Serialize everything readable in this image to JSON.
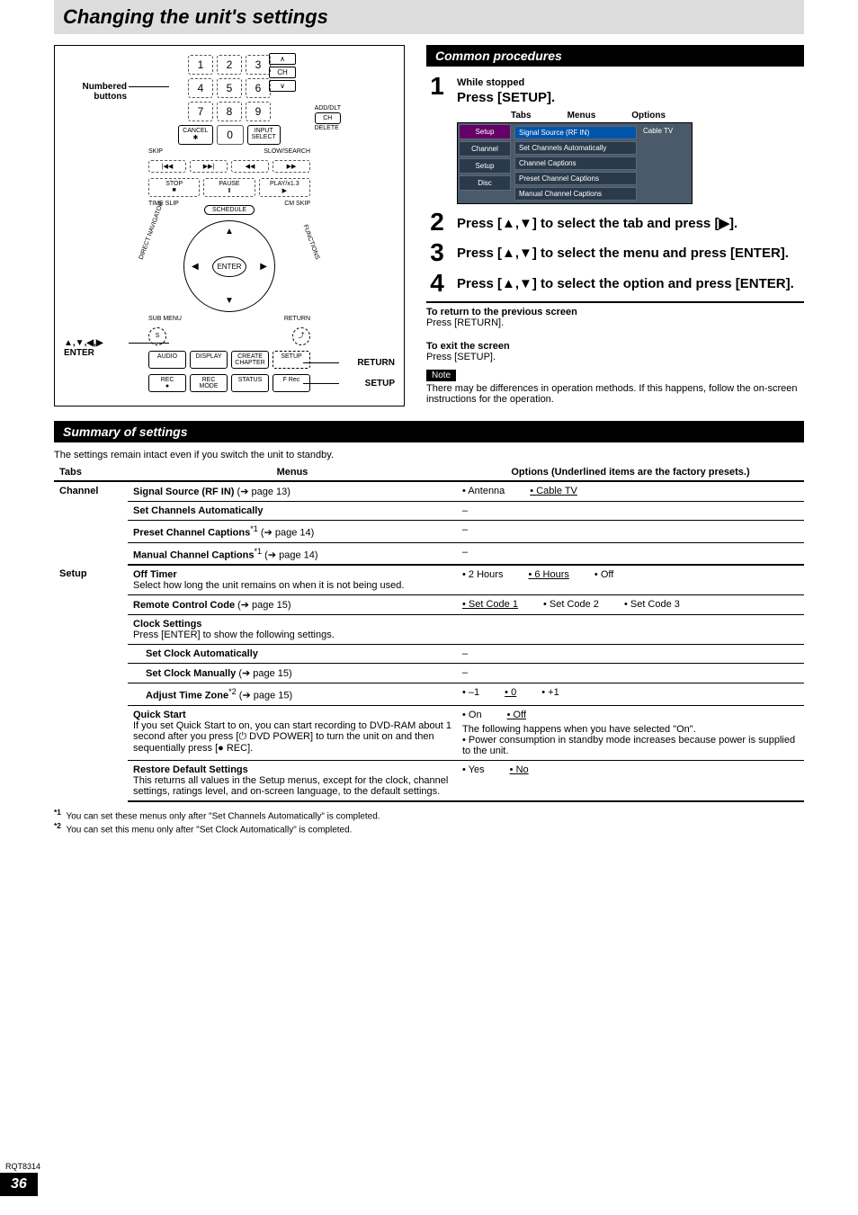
{
  "title": "Changing the unit's settings",
  "remote": {
    "label_numbered": "Numbered buttons",
    "label_enter": "▲,▼,◀,▶\nENTER",
    "label_return": "RETURN",
    "label_setup": "SETUP",
    "keys": [
      "1",
      "2",
      "3",
      "4",
      "5",
      "6",
      "7",
      "8",
      "9",
      "0"
    ],
    "side1_top": "∧",
    "side1_mid": "CH",
    "side1_bot": "∨",
    "side2_a": "ADD/DLT",
    "side2_b": "CH",
    "side2_c": "DELETE",
    "cancel": "CANCEL\n✱",
    "input": "INPUT\nSELECT",
    "skip": "SKIP",
    "slow": "SLOW/SEARCH",
    "prev": "|◀◀",
    "next": "▶▶|",
    "rew": "◀◀",
    "fwd": "▶▶",
    "stop": "STOP\n■",
    "pause": "PAUSE\nⅡ",
    "play": "PLAY/x1.3\n▶",
    "timeslip": "TIME SLIP",
    "cmskip": "CM SKIP",
    "schedule": "SCHEDULE",
    "enter": "ENTER",
    "submenu": "SUB MENU",
    "return": "RETURN",
    "s": "S",
    "row_audio": "AUDIO",
    "row_display": "DISPLAY",
    "row_create": "CREATE\nCHAPTER",
    "row_setup": "SETUP",
    "row2_rec": "REC",
    "row2_recmode": "REC MODE",
    "row2_status": "STATUS",
    "row2_frec": "F Rec",
    "direct": "DIRECT NAVIGATOR",
    "functions": "FUNCTIONS"
  },
  "procedures": {
    "header": "Common procedures",
    "step1_small": "While stopped",
    "step1_main": "Press [SETUP].",
    "osd_tabs_label": "Tabs",
    "osd_menus_label": "Menus",
    "osd_options_label": "Options",
    "osd_tab1": "Setup",
    "osd_tab2": "Channel",
    "osd_tab3": "Setup",
    "osd_tab4": "Disc",
    "osd_m1": "Signal Source (RF IN)",
    "osd_m2": "Set Channels Automatically",
    "osd_m3": "Channel Captions",
    "osd_m4": "Preset Channel Captions",
    "osd_m5": "Manual Channel Captions",
    "osd_opt": "Cable TV",
    "step2": "Press [▲,▼] to select the tab and press [▶].",
    "step3": "Press [▲,▼] to select the menu and press [ENTER].",
    "step4": "Press [▲,▼] to select the option and press [ENTER].",
    "return_h": "To return to the previous screen",
    "return_t": "Press [RETURN].",
    "exit_h": "To exit the screen",
    "exit_t": "Press [SETUP].",
    "note_label": "Note",
    "note_t": "There may be differences in operation methods. If this happens, follow the on-screen instructions for the operation."
  },
  "summary": {
    "header": "Summary of settings",
    "intro": "The settings remain intact even if you switch the unit to standby.",
    "col_tabs": "Tabs",
    "col_menus": "Menus",
    "col_options": "Options (Underlined items are the factory presets.)",
    "tab_channel": "Channel",
    "tab_setup": "Setup",
    "rows": {
      "signal": {
        "menu": "Signal Source (RF IN)",
        "ref": " (➔ page 13)",
        "opts": [
          "Antenna",
          "Cable TV"
        ],
        "u": []
      },
      "setch": {
        "menu": "Set Channels Automatically",
        "opts": [
          "–"
        ]
      },
      "preset": {
        "menu": "Preset Channel Captions",
        "sup": "*1",
        "ref": " (➔ page 14)",
        "opts": [
          "–"
        ]
      },
      "manual": {
        "menu": "Manual Channel Captions",
        "sup": "*1",
        "ref": " (➔ page 14)",
        "opts": [
          "–"
        ]
      },
      "off": {
        "menu": "Off Timer",
        "desc": "Select how long the unit remains on when it is not being used.",
        "opts": [
          "2 Hours",
          "6 Hours",
          "Off"
        ],
        "u": [
          1
        ]
      },
      "rcc": {
        "menu": "Remote Control Code",
        "ref": " (➔ page 15)",
        "opts": [
          "Set Code 1",
          "Set Code 2",
          "Set Code 3"
        ],
        "u": [
          0
        ]
      },
      "clock": {
        "menu": "Clock Settings",
        "desc": "Press [ENTER] to show the following settings."
      },
      "clk_auto": {
        "menu": "Set Clock Automatically",
        "opts": [
          "–"
        ]
      },
      "clk_man": {
        "menu": "Set Clock Manually",
        "ref": " (➔ page 15)",
        "opts": [
          "–"
        ]
      },
      "clk_tz": {
        "menu": "Adjust Time Zone",
        "sup": "*2",
        "ref": " (➔ page 15)",
        "opts": [
          "–1",
          "0",
          "+1"
        ],
        "u": [
          1
        ]
      },
      "quick": {
        "menu": "Quick Start",
        "desc": "If you set Quick Start to on, you can start recording to DVD-RAM about 1 second after you press [⏻ DVD POWER] to turn the unit on and then sequentially press [● REC].",
        "opts": [
          "On",
          "Off"
        ],
        "u": [
          1
        ],
        "extra": "The following happens when you have selected \"On\".\n• Power consumption in standby mode increases because power is supplied to the unit."
      },
      "restore": {
        "menu": "Restore Default Settings",
        "desc": "This returns all values in the Setup menus, except for the clock, channel settings, ratings level, and on-screen language, to the default settings.",
        "opts": [
          "Yes",
          "No"
        ],
        "u": [
          1
        ]
      }
    },
    "fn1": "You can set these menus only after \"Set Channels Automatically\" is completed.",
    "fn2": "You can set this menu only after \"Set Clock Automatically\" is completed."
  },
  "footer": {
    "rqt": "RQT8314",
    "page": "36"
  }
}
